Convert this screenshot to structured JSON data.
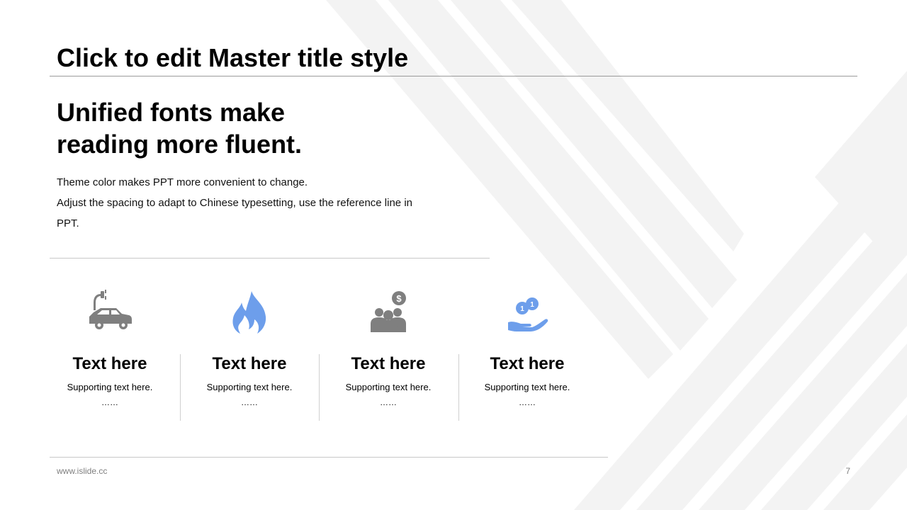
{
  "slide": {
    "title": "Click to edit Master title style",
    "headline_line1": "Unified fonts make",
    "headline_line2": "reading more fluent.",
    "body_line1": "Theme color makes PPT more convenient to change.",
    "body_line2": "Adjust the spacing to adapt to Chinese typesetting, use the reference line in PPT."
  },
  "features": [
    {
      "icon": "electric-car-icon",
      "title": "Text here",
      "subtitle": "Supporting  text here.",
      "dots": "……"
    },
    {
      "icon": "flame-icon",
      "title": "Text here",
      "subtitle": "Supporting  text here.",
      "dots": "……"
    },
    {
      "icon": "people-money-icon",
      "title": "Text here",
      "subtitle": "Supporting  text here.",
      "dots": "……"
    },
    {
      "icon": "coins-hand-icon",
      "title": "Text here",
      "subtitle": "Supporting  text here.",
      "dots": "……"
    }
  ],
  "footer": {
    "url": "www.islide.cc",
    "page_number": "7"
  },
  "colors": {
    "accent_blue": "#6d9eeb",
    "icon_gray": "#7f7f7f",
    "text": "#000000",
    "footer_text": "#7f7f7f"
  }
}
